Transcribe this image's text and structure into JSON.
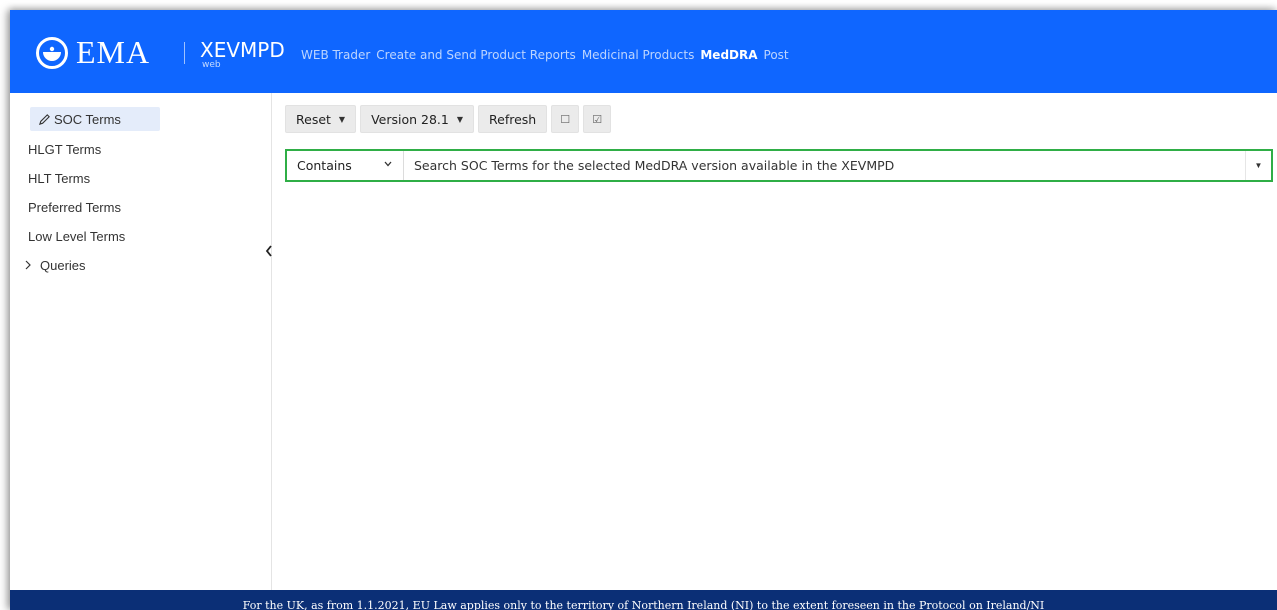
{
  "header": {
    "brand": "EMA",
    "product": "XEVMPD",
    "product_sub": "web",
    "nav": [
      "WEB Trader",
      "Create and Send Product Reports",
      "Medicinal Products",
      "MedDRA",
      "Post"
    ],
    "active_nav": "MedDRA",
    "bg_color": "#0f66ff"
  },
  "sidebar": {
    "items": [
      {
        "label": "SOC Terms",
        "icon": "pencil-icon",
        "active": true
      },
      {
        "label": "HLGT Terms"
      },
      {
        "label": "HLT Terms"
      },
      {
        "label": "Preferred Terms"
      },
      {
        "label": "Low Level Terms"
      },
      {
        "label": "Queries",
        "icon": "chevron-right-icon"
      }
    ]
  },
  "toolbar": {
    "reset_label": "Reset",
    "version_label": "Version 28.1",
    "refresh_label": "Refresh",
    "checkbox_empty_glyph": "☐",
    "checkbox_checked_glyph": "☑"
  },
  "search": {
    "mode": "Contains",
    "placeholder": "Search SOC Terms for the selected MedDRA version available in the XEVMPD",
    "highlight_color": "#2fae46"
  },
  "footer": {
    "text": "For the UK, as from 1.1.2021, EU Law applies only to the territory of Northern Ireland (NI) to the extent foreseen in the Protocol on Ireland/NI",
    "bg_color": "#0b2f76"
  }
}
